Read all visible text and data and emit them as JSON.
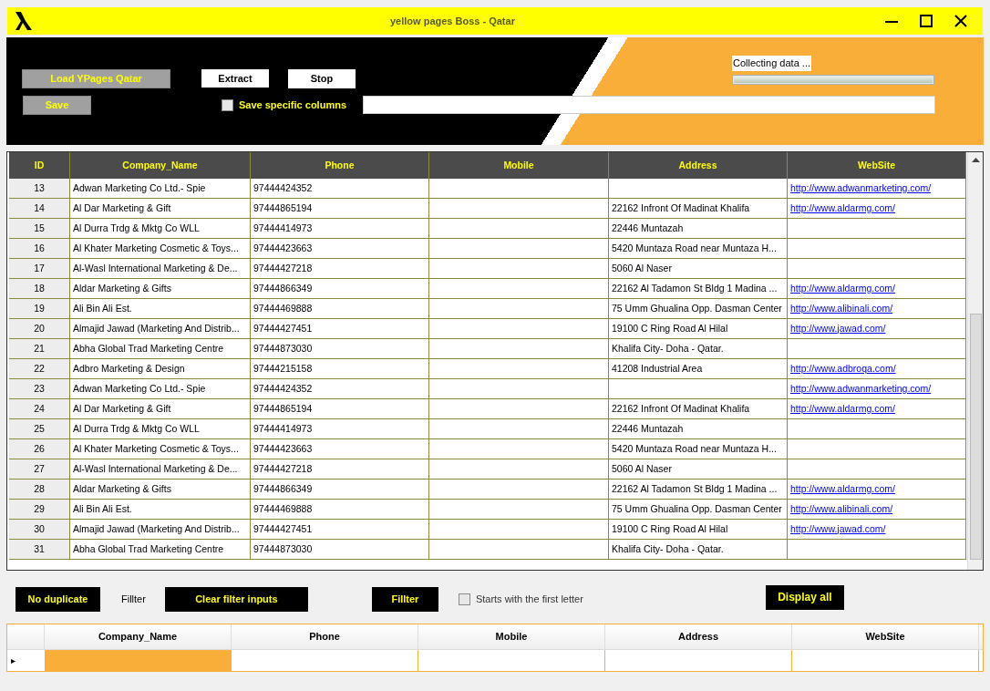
{
  "window": {
    "title": "yellow pages Boss - Qatar"
  },
  "toolbar": {
    "load_button": {
      "label": "Load YPages Qatar",
      "disabled": true
    },
    "extract_button": "Extract",
    "stop_button": "Stop",
    "save_button": {
      "label": "Save",
      "disabled": true
    },
    "save_columns": {
      "label": "Save specific columns",
      "checked": false
    },
    "status": "Collecting data ...",
    "progress": {
      "level": 1
    }
  },
  "table": {
    "columns": [
      "ID",
      "Company_Name",
      "Phone",
      "Mobile",
      "Address",
      "WebSite"
    ],
    "rows": [
      {
        "id": "13",
        "company": "Adwan Marketing Co Ltd.- Spie",
        "phone": "97444424352",
        "website": "http://www.adwanmarketing.com/"
      },
      {
        "id": "14",
        "company": "Al Dar Marketing & Gift",
        "phone": "97444865194",
        "address": "22162 Infront Of Madinat Khalifa",
        "website": "http://www.aldarmg.com/"
      },
      {
        "id": "15",
        "company": "Al Durra Trdg & Mktg Co WLL",
        "phone": "97444414973",
        "address": "22446 Muntazah"
      },
      {
        "id": "16",
        "company": "Al Khater Marketing Cosmetic & Toys...",
        "phone": "97444423663",
        "address": "5420 Muntaza Road near Muntaza H..."
      },
      {
        "id": "17",
        "company": "Al-Wasl International Marketing & De...",
        "phone": "97444427218",
        "address": "5060 Al Naser"
      },
      {
        "id": "18",
        "company": "Aldar Marketing & Gifts",
        "phone": "97444866349",
        "address": "22162 Al Tadamon St Bldg 1 Madina ...",
        "website": "http://www.aldarmg.com/"
      },
      {
        "id": "19",
        "company": "Ali Bin Ali Est.",
        "phone": "97444469888",
        "address": "75 Umm Ghualina Opp. Dasman Center",
        "website": "http://www.alibinali.com/"
      },
      {
        "id": "20",
        "company": "Almajid Jawad (Marketing And Distrib...",
        "phone": "97444427451",
        "address": "19100 C Ring Road Al Hilal",
        "website": "http://www.jawad.com/"
      },
      {
        "id": "21",
        "company": "Abha Global Trad Marketing Centre",
        "phone": "97444873030",
        "address": "Khalifa City- Doha - Qatar."
      },
      {
        "id": "22",
        "company": "Adbro Marketing & Design",
        "phone": "97444215158",
        "address": "41208 Industrial Area",
        "website": "http://www.adbroqa.com/"
      },
      {
        "id": "23",
        "company": "Adwan Marketing Co Ltd.- Spie",
        "phone": "97444424352",
        "website": "http://www.adwanmarketing.com/"
      },
      {
        "id": "24",
        "company": "Al Dar Marketing & Gift",
        "phone": "97444865194",
        "address": "22162 Infront Of Madinat Khalifa",
        "website": "http://www.aldarmg.com/"
      },
      {
        "id": "25",
        "company": "Al Durra Trdg & Mktg Co WLL",
        "phone": "97444414973",
        "address": "22446 Muntazah"
      },
      {
        "id": "26",
        "company": "Al Khater Marketing Cosmetic & Toys...",
        "phone": "97444423663",
        "address": "5420 Muntaza Road near Muntaza H..."
      },
      {
        "id": "27",
        "company": "Al-Wasl International Marketing & De...",
        "phone": "97444427218",
        "address": "5060 Al Naser"
      },
      {
        "id": "28",
        "company": "Aldar Marketing & Gifts",
        "phone": "97444866349",
        "address": "22162 Al Tadamon St Bldg 1 Madina ...",
        "website": "http://www.aldarmg.com/"
      },
      {
        "id": "29",
        "company": "Ali Bin Ali Est.",
        "phone": "97444469888",
        "address": "75 Umm Ghualina Opp. Dasman Center",
        "website": "http://www.alibinali.com/"
      },
      {
        "id": "30",
        "company": "Almajid Jawad (Marketing And Distrib...",
        "phone": "97444427451",
        "address": "19100 C Ring Road Al Hilal",
        "website": "http://www.jawad.com/"
      },
      {
        "id": "31",
        "company": "Abha Global Trad Marketing Centre",
        "phone": "97444873030",
        "address": "Khalifa City- Doha - Qatar."
      }
    ]
  },
  "filter_bar": {
    "no_duplicate_button": "No duplicate",
    "filter_label": "Fillter",
    "clear_button": "Clear filter inputs",
    "filter_button": "Fillter",
    "first_letter": {
      "label": "Starts with the first letter",
      "checked": false
    },
    "display_all_button": "Display all"
  },
  "filter_grid": {
    "columns": [
      "Company_Name",
      "Phone",
      "Mobile",
      "Address",
      "WebSite"
    ],
    "row_marker": "▸"
  }
}
